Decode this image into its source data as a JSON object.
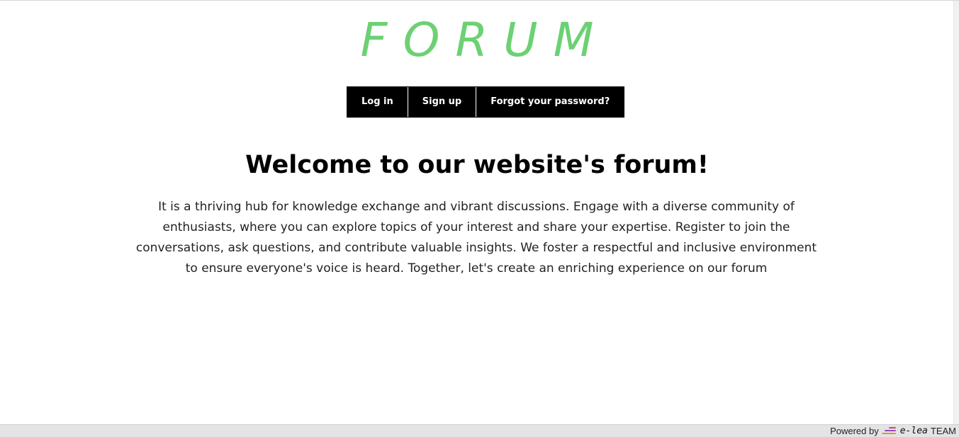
{
  "header": {
    "logo_text": "FORUM"
  },
  "nav": {
    "items": [
      {
        "label": "Log in"
      },
      {
        "label": "Sign up"
      },
      {
        "label": "Forgot your password?"
      }
    ]
  },
  "main": {
    "headline": "Welcome to our website's forum!",
    "intro": "It is a thriving hub for knowledge exchange and vibrant discussions. Engage with a diverse community of enthusiasts, where you can explore topics of your interest and share your expertise. Register to join the conversations, ask questions, and contribute valuable insights. We foster a respectful and inclusive environment to ensure everyone's voice is heard. Together, let's create an enriching experience on our forum"
  },
  "footer": {
    "powered_label": "Powered by",
    "brand_name": "e-lea",
    "brand_suffix": "TEAM"
  },
  "colors": {
    "logo": "#6cd173",
    "nav_background": "#000000",
    "nav_text": "#ffffff"
  },
  "icons": {
    "brand_logo": "e-lea-logo-icon"
  }
}
